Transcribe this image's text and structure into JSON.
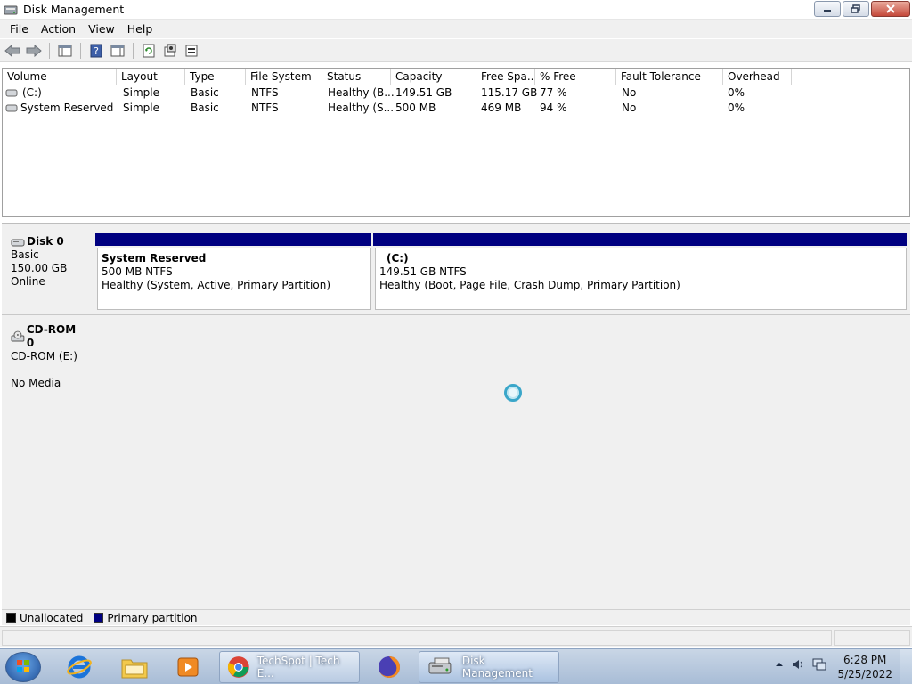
{
  "window": {
    "title": "Disk Management"
  },
  "menu": [
    "File",
    "Action",
    "View",
    "Help"
  ],
  "volume_table": {
    "columns": [
      "Volume",
      "Layout",
      "Type",
      "File System",
      "Status",
      "Capacity",
      "Free Spa...",
      "% Free",
      "Fault Tolerance",
      "Overhead"
    ],
    "rows": [
      {
        "volume": "(C:)",
        "layout": "Simple",
        "type": "Basic",
        "fs": "NTFS",
        "status": "Healthy (B...",
        "capacity": "149.51 GB",
        "free": "115.17 GB",
        "pct_free": "77 %",
        "fault": "No",
        "overhead": "0%"
      },
      {
        "volume": "System Reserved",
        "layout": "Simple",
        "type": "Basic",
        "fs": "NTFS",
        "status": "Healthy (S...",
        "capacity": "500 MB",
        "free": "469 MB",
        "pct_free": "94 %",
        "fault": "No",
        "overhead": "0%"
      }
    ]
  },
  "disks": [
    {
      "name": "Disk 0",
      "kind": "Basic",
      "size": "150.00 GB",
      "state": "Online",
      "partitions": [
        {
          "name": "System Reserved",
          "size": "500 MB NTFS",
          "status": "Healthy (System, Active, Primary Partition)"
        },
        {
          "name": "(C:)",
          "size": "149.51 GB NTFS",
          "status": "Healthy (Boot, Page File, Crash Dump, Primary Partition)"
        }
      ]
    },
    {
      "name": "CD-ROM 0",
      "kind": "CD-ROM (E:)",
      "state": "No Media"
    }
  ],
  "legend": [
    {
      "label": "Unallocated",
      "color": "#000000"
    },
    {
      "label": "Primary partition",
      "color": "#000080"
    }
  ],
  "taskbar": {
    "tasks": [
      {
        "label": "TechSpot | Tech E...",
        "icon": "chrome-icon"
      },
      {
        "label": "Disk Management",
        "icon": "disk-management-icon"
      }
    ],
    "time": "6:28 PM",
    "date": "5/25/2022"
  }
}
